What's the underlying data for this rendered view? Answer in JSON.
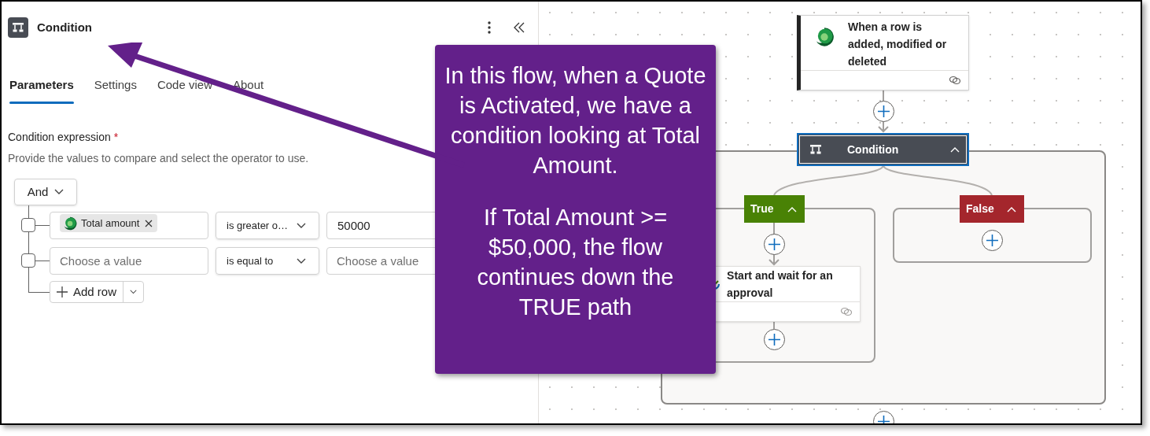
{
  "panel": {
    "title": "Condition",
    "tabs": [
      {
        "label": "Parameters",
        "selected": true
      },
      {
        "label": "Settings",
        "selected": false
      },
      {
        "label": "Code view",
        "selected": false
      },
      {
        "label": "About",
        "selected": false
      }
    ],
    "expression_label": "Condition expression",
    "required_mark": "*",
    "description": "Provide the values to compare and select the operator to use.",
    "group_operator": "And",
    "rows": [
      {
        "kind": "token",
        "checked": false,
        "token": "Total amount",
        "operator": "is greater o…",
        "value": "50000"
      },
      {
        "kind": "empty",
        "checked": false,
        "placeholder": "Choose a value",
        "operator": "is equal to",
        "value_placeholder": "Choose a value"
      }
    ],
    "add_row": "Add row"
  },
  "callout": {
    "paragraphs": [
      "In this flow, when a Quote is Activated, we have a condition looking at Total Amount.",
      "If Total Amount >= $50,000, the flow continues down the TRUE path"
    ]
  },
  "flow": {
    "trigger": {
      "title": "When a row is added, modified or deleted"
    },
    "condition": {
      "title": "Condition",
      "expanded": true
    },
    "branches": [
      {
        "kind": "true",
        "label": "True",
        "expanded": true
      },
      {
        "kind": "false",
        "label": "False",
        "expanded": true
      }
    ],
    "true_actions": [
      {
        "title": "Start and wait for an approval"
      }
    ]
  }
}
